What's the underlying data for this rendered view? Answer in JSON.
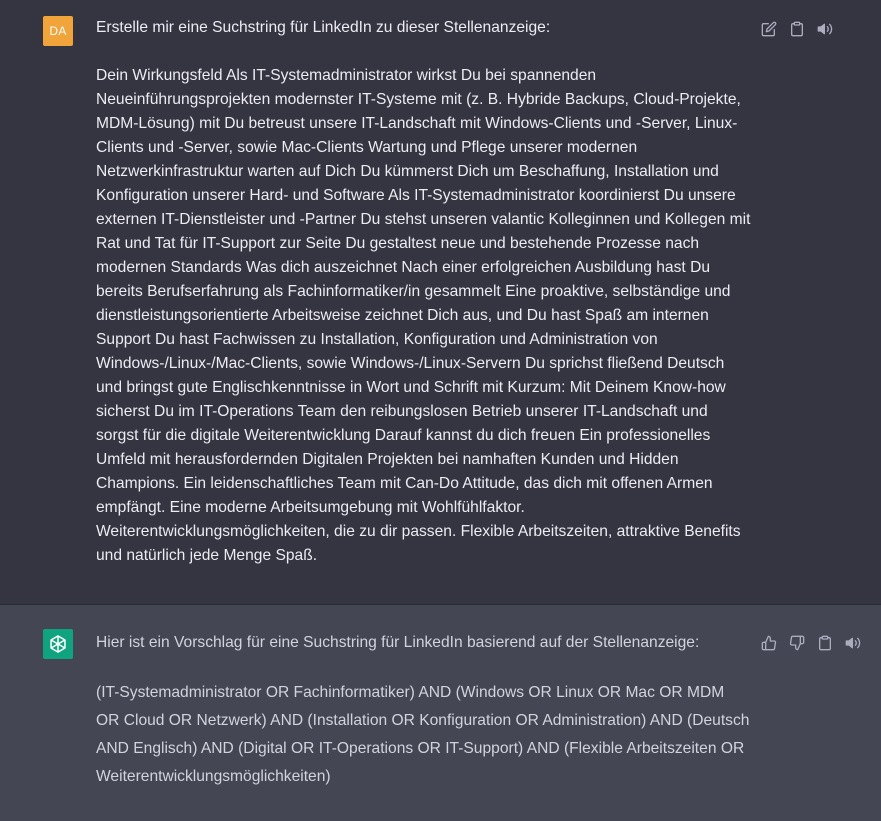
{
  "user_message": {
    "avatar_initials": "DA",
    "avatar_color": "#f0a43a",
    "heading": "Erstelle mir eine Suchstring für LinkedIn zu dieser Stellenanzeige:",
    "body": "Dein Wirkungsfeld Als IT-Systemadministrator wirkst Du bei spannenden Neueinführungsprojekten modernster IT-Systeme mit (z. B. Hybride Backups, Cloud-Projekte, MDM-Lösung) mit Du betreust unsere IT-Landschaft mit Windows-Clients und -Server, Linux-Clients und -Server, sowie Mac-Clients Wartung und Pflege unserer modernen Netzwerkinfrastruktur warten auf Dich Du kümmerst Dich um Beschaffung, Installation und Konfiguration unserer Hard- und Software Als IT-Systemadministrator koordinierst Du unsere externen IT-Dienstleister und -Partner Du stehst unseren valantic Kolleginnen und Kollegen mit Rat und Tat für IT-Support zur Seite Du gestaltest neue und bestehende Prozesse nach modernen Standards Was dich auszeichnet Nach einer erfolgreichen Ausbildung hast Du bereits Berufserfahrung als Fachinformatiker/in gesammelt Eine proaktive, selbständige und dienstleistungsorientierte Arbeitsweise zeichnet Dich aus, und Du hast Spaß am internen Support Du hast Fachwissen zu Installation, Konfiguration und Administration von Windows-/Linux-/Mac-Clients, sowie Windows-/Linux-Servern Du sprichst fließend Deutsch und bringst gute Englischkenntnisse in Wort und Schrift mit Kurzum: Mit Deinem Know-how sicherst Du im IT-Operations Team den reibungslosen Betrieb unserer IT-Landschaft und sorgst für die digitale Weiterentwicklung Darauf kannst du dich freuen Ein professionelles Umfeld mit herausfordernden Digitalen Projekten bei namhaften Kunden und Hidden Champions. Ein leidenschaftliches Team mit Can-Do Attitude, das dich mit offenen Armen empfängt. Eine moderne Arbeitsumgebung mit Wohlfühlfaktor. Weiterentwicklungsmöglichkeiten, die zu dir passen. Flexible Arbeitszeiten, attraktive Benefits und natürlich jede Menge Spaß.",
    "actions": [
      "edit-icon",
      "clipboard-icon",
      "speaker-icon"
    ]
  },
  "assistant_message": {
    "avatar_icon": "openai-logo-icon",
    "avatar_color": "#10a37f",
    "intro": "Hier ist ein Vorschlag für eine Suchstring für LinkedIn basierend auf der Stellenanzeige:",
    "query": "(IT-Systemadministrator OR Fachinformatiker) AND (Windows OR Linux OR Mac OR MDM OR Cloud OR Netzwerk) AND (Installation OR Konfiguration OR Administration) AND (Deutsch AND Englisch) AND (Digital OR IT-Operations OR IT-Support) AND (Flexible Arbeitszeiten OR Weiterentwicklungsmöglichkeiten)",
    "actions": [
      "thumbs-up-icon",
      "thumbs-down-icon",
      "clipboard-icon",
      "speaker-icon"
    ]
  }
}
